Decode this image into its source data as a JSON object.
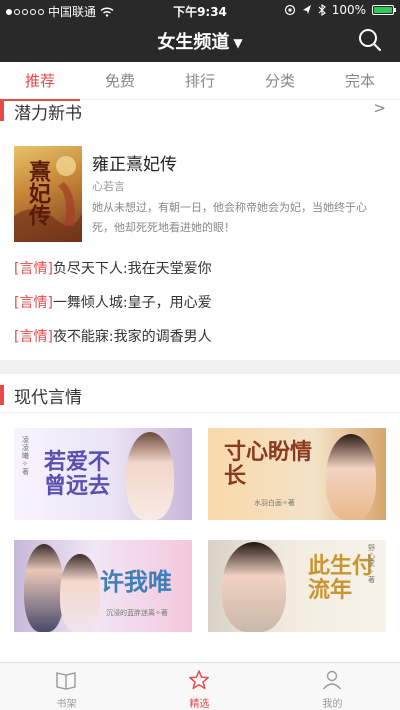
{
  "status_bar": {
    "carrier": "中国联通",
    "time": "下午9:34",
    "battery": "100%",
    "battery_level": 1.0
  },
  "nav": {
    "title": "女生频道",
    "icons": [
      "chevron-down-icon",
      "search-icon"
    ]
  },
  "tabs": [
    {
      "label": "推荐",
      "active": true
    },
    {
      "label": "免费",
      "active": false
    },
    {
      "label": "排行",
      "active": false
    },
    {
      "label": "分类",
      "active": false
    },
    {
      "label": "完本",
      "active": false
    }
  ],
  "section_new": {
    "title": "潜力新书",
    "more": ">"
  },
  "featured": {
    "cover_text": "熹妃传",
    "title": "雍正熹妃传",
    "author": "心若言",
    "description": "她从未想过，有朝一日，他会称帝她会为妃，当她终于心死，他却死死地看进她的眼！"
  },
  "recommend_list": [
    {
      "tag": "[言情]",
      "text": "负尽天下人:我在天堂爱你"
    },
    {
      "tag": "[言情]",
      "text": "一舞倾人城:皇子，用心爱"
    },
    {
      "tag": "[言情]",
      "text": "夜不能寐:我家的调香男人"
    }
  ],
  "section_modern": {
    "title": "现代言情"
  },
  "grid": [
    {
      "title": "若爱不曾远去",
      "author": "凌凌曦✧著"
    },
    {
      "title": "寸心盼情长",
      "author": "水羽白画✧著"
    },
    {
      "title": "许我唯",
      "author": "沉浸的蓝胖迷离✧著"
    },
    {
      "title": "此生付流年",
      "author": "野心家✧著"
    }
  ],
  "tabbar": [
    {
      "label": "书架",
      "icon": "book-icon",
      "active": false
    },
    {
      "label": "精选",
      "icon": "star-icon",
      "active": true
    },
    {
      "label": "我的",
      "icon": "user-icon",
      "active": false
    }
  ],
  "colors": {
    "accent": "#e84a4a",
    "top_bar": "#292929",
    "battery_fill": "#34c759"
  }
}
